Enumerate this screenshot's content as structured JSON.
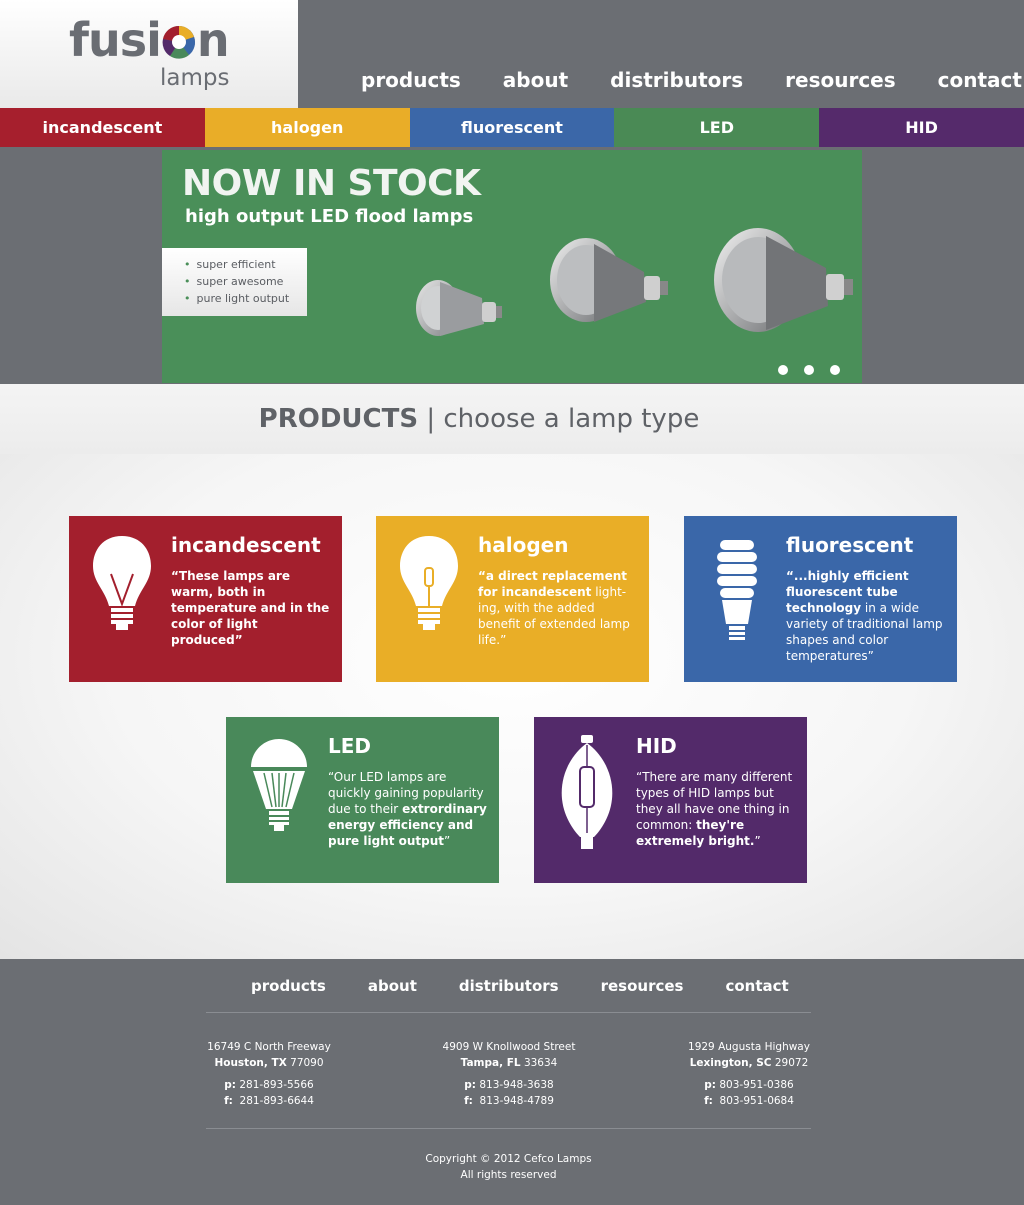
{
  "brand": {
    "name_part1": "fusi",
    "name_part2": "n",
    "sub": "lamps"
  },
  "nav": [
    "products",
    "about",
    "distributors",
    "resources",
    "contact"
  ],
  "lamp_types": [
    "incandescent",
    "halogen",
    "fluorescent",
    "LED",
    "HID"
  ],
  "hero": {
    "title": "NOW IN STOCK",
    "subtitle": "high output LED flood lamps",
    "features": [
      "super efficient",
      "super awesome",
      "pure light output"
    ],
    "slides": 3
  },
  "products_heading": {
    "bold": "PRODUCTS",
    "separator": "|",
    "rest": "choose a lamp type"
  },
  "cards": {
    "incandescent": {
      "title": "incandescent",
      "text": "“These lamps are warm, both in temperature and in the color of light produced”"
    },
    "halogen": {
      "title": "halogen",
      "bold": "“a direct replacement for incandescent",
      "text": " light-ing, with the added benefit of extended lamp life.”"
    },
    "fluorescent": {
      "title": "fluorescent",
      "bold": "“...highly efficient fluorescent tube technology",
      "text": " in a wide variety of traditional lamp shapes and color temperatures”"
    },
    "led": {
      "title": "LED",
      "text": "“Our LED lamps are quickly gaining popularity due to their ",
      "bold": "extrordinary energy efficiency and pure light output",
      "end": "”"
    },
    "hid": {
      "title": "HID",
      "text": "“There are many different types of HID lamps but they all have one thing in common: ",
      "bold": "they're extremely bright.",
      "end": "”"
    }
  },
  "footer": {
    "nav": [
      "products",
      "about",
      "distributors",
      "resources",
      "contact"
    ],
    "locations": [
      {
        "street": "16749 C North Freeway",
        "city": "Houston, TX",
        "zip": "77090",
        "phone": "281-893-5566",
        "fax": "281-893-6644"
      },
      {
        "street": "4909 W Knollwood Street",
        "city": "Tampa, FL",
        "zip": "33634",
        "phone": "813-948-3638",
        "fax": "813-948-4789"
      },
      {
        "street": "1929 Augusta Highway",
        "city": "Lexington, SC",
        "zip": "29072",
        "phone": "803-951-0386",
        "fax": "803-951-0684"
      }
    ],
    "phone_label": "p:",
    "fax_label": "f:",
    "copyright": "Copyright © 2012 Cefco Lamps",
    "rights": "All rights reserved"
  },
  "colors": {
    "incandescent": "#a31f2d",
    "halogen": "#e9ae27",
    "fluorescent": "#3a67a9",
    "led": "#49895a",
    "hid": "#532a6a",
    "gray": "#6b6e73"
  }
}
